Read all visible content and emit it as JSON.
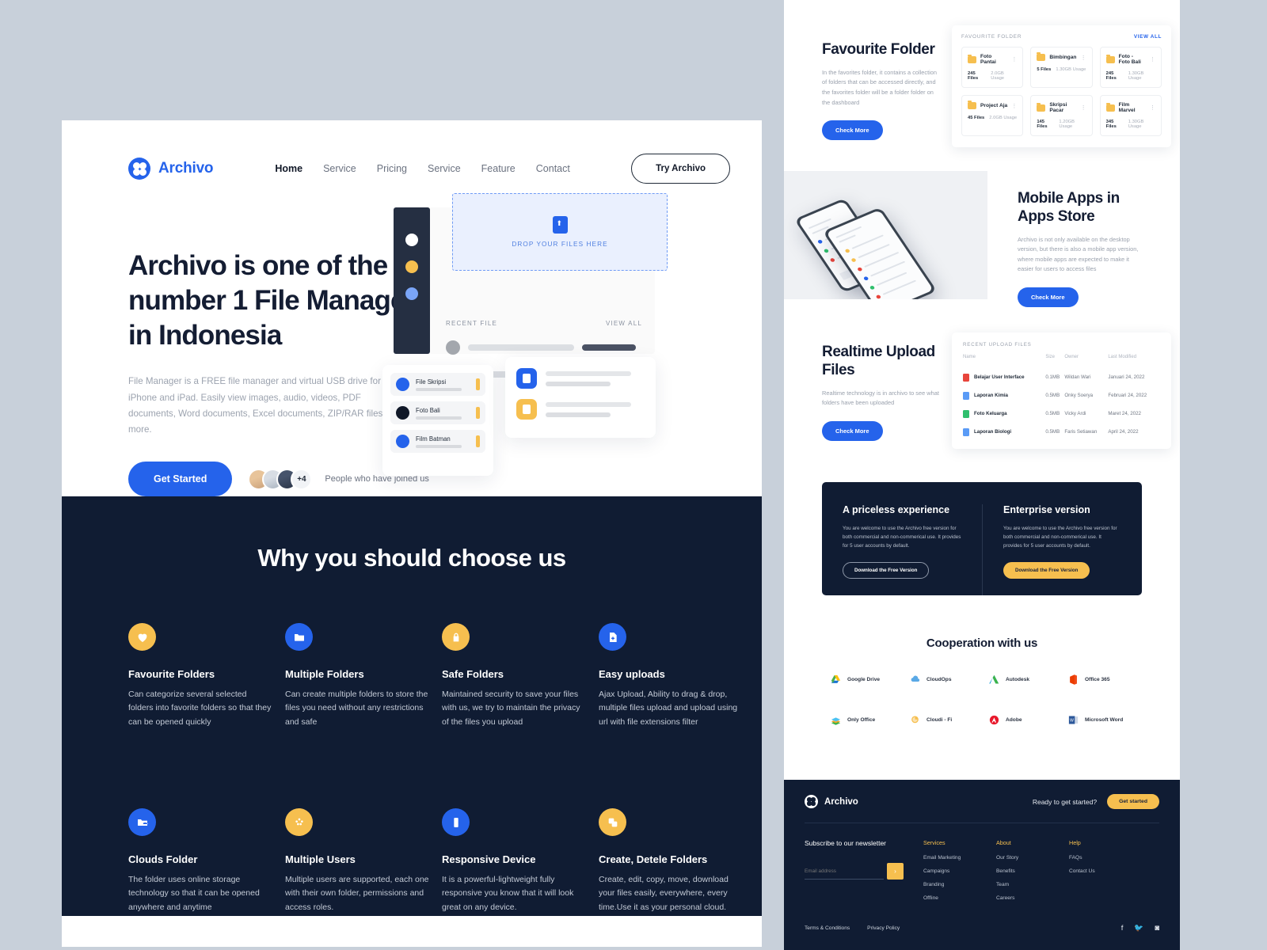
{
  "nav": {
    "brand": "Archivo",
    "links": [
      {
        "label": "Home",
        "active": true
      },
      {
        "label": "Service",
        "active": false
      },
      {
        "label": "Pricing",
        "active": false
      },
      {
        "label": "Service",
        "active": false
      },
      {
        "label": "Feature",
        "active": false
      },
      {
        "label": "Contact",
        "active": false
      }
    ],
    "cta": "Try Archivo"
  },
  "hero": {
    "title": "Archivo is one of the number 1 File Manager in Indonesia",
    "subtitle": "File Manager is a FREE file manager and virtual USB drive for the iPhone and iPad. Easily view images, audio, videos, PDF documents, Word documents, Excel documents, ZIP/RAR files and more.",
    "cta": "Get Started",
    "avatar_more": "+4",
    "joined_text": "People who have joined us",
    "dropzone_text": "DROP YOUR FILES HERE",
    "recent_label": "RECENT FILE",
    "view_all": "VIEW ALL",
    "files": [
      {
        "name": "File Skripsi",
        "color": "blue"
      },
      {
        "name": "Foto Bali",
        "color": "dark"
      },
      {
        "name": "Film Batman",
        "color": "blue"
      }
    ]
  },
  "why": {
    "title": "Why you should choose us",
    "features": [
      {
        "icon": "heart-icon",
        "tone": "yellow",
        "name": "Favourite Folders",
        "desc": "Can categorize several selected folders into favorite folders so that they can be opened quickly"
      },
      {
        "icon": "folder-icon",
        "tone": "blue",
        "name": "Multiple Folders",
        "desc": "Can create multiple folders to store the files you need without any restrictions and safe"
      },
      {
        "icon": "lock-icon",
        "tone": "yellow",
        "name": "Safe Folders",
        "desc": "Maintained security to save your files with us, we try to maintain the privacy of the files you upload"
      },
      {
        "icon": "upload-file-icon",
        "tone": "blue",
        "name": "Easy uploads",
        "desc": "Ajax Upload, Ability to drag & drop, multiple files upload and upload using url with file extensions filter"
      },
      {
        "icon": "cloud-folder-icon",
        "tone": "blue",
        "name": "Clouds Folder",
        "desc": "The folder uses online storage technology so that it can be opened anywhere and anytime"
      },
      {
        "icon": "users-icon",
        "tone": "yellow",
        "name": "Multiple Users",
        "desc": "Multiple users are supported, each one with their own folder, permissions and access roles."
      },
      {
        "icon": "mobile-icon",
        "tone": "blue",
        "name": "Responsive Device",
        "desc": "It is a powerful-lightweight fully responsive you know that it will look great on any device."
      },
      {
        "icon": "copy-icon",
        "tone": "yellow",
        "name": "Create, Detele Folders",
        "desc": "Create, edit, copy, move, download your files easily, everywhere, every time.Use it as your personal cloud."
      }
    ]
  },
  "favourite": {
    "heading": "Favourite Folder",
    "paragraph": "In the favorites folder, it contains a collection of folders that can be accessed directly, and the favorites folder will be a folder folder on the dashboard",
    "button": "Check More",
    "card_title": "FAVOURITE FOLDER",
    "view_all": "VIEW ALL",
    "folders": [
      {
        "name": "Foto Pantai",
        "files": "245 Files",
        "usage": "2.0GB Usage"
      },
      {
        "name": "Bimbingan",
        "files": "5 Files",
        "usage": "1.30GB Usage"
      },
      {
        "name": "Foto - Foto Bali",
        "files": "245 Files",
        "usage": "1.30GB Usage"
      },
      {
        "name": "Project Aja",
        "files": "45 Files",
        "usage": "2.0GB Usage"
      },
      {
        "name": "Skripsi Pacar",
        "files": "145 Files",
        "usage": "1.20GB Usage"
      },
      {
        "name": "Film Marvel",
        "files": "345 Files",
        "usage": "1.30GB Usage"
      }
    ]
  },
  "mobile": {
    "heading": "Mobile Apps in Apps Store",
    "paragraph": "Archivo is not only available on the desktop version, but there is also a mobile app version, where mobile apps are expected to make it easier for users to access files",
    "button": "Check More"
  },
  "realtime": {
    "heading": "Realtime Upload Files",
    "paragraph": "Realtime technology is in archivo to see what folders have been uploaded",
    "button": "Check More",
    "card_title": "RECENT UPLOAD FILES",
    "columns": [
      "Name",
      "Size",
      "Owner",
      "Last Modified"
    ],
    "rows": [
      {
        "name": "Belajar User Interface",
        "size": "0.1MB",
        "owner": "Wildan Wari",
        "modified": "Januari 24, 2022",
        "tone": "red"
      },
      {
        "name": "Laporan Kimia",
        "size": "0.5MB",
        "owner": "Onky Soerya",
        "modified": "Februari 24, 2022",
        "tone": "blue"
      },
      {
        "name": "Foto Keluarga",
        "size": "0.5MB",
        "owner": "Vicky Ardi",
        "modified": "Maret 24, 2022",
        "tone": "green"
      },
      {
        "name": "Laporan Biologi",
        "size": "0.5MB",
        "owner": "Faris Setiawan",
        "modified": "April 24, 2022",
        "tone": "blue"
      }
    ]
  },
  "pricing": {
    "left": {
      "heading": "A priceless experience",
      "paragraph": "You are welcome to use the Archivo free version for both commercial and non-commerical use. It provides for 5 user accounts by default.",
      "button": "Download the Free Version"
    },
    "right": {
      "heading": "Enterprise version",
      "paragraph": "You are welcome to use the Archivo free version for both commercial and non-commerical use. It provides for 5 user accounts by default.",
      "button": "Download the Free Version"
    }
  },
  "cooperation": {
    "heading": "Cooperation with us",
    "partners": [
      {
        "name": "Google Drive",
        "logo": "google-drive-logo"
      },
      {
        "name": "CloudOps",
        "logo": "cloudops-logo"
      },
      {
        "name": "Autodesk",
        "logo": "autodesk-logo"
      },
      {
        "name": "Office 365",
        "logo": "office365-logo"
      },
      {
        "name": "Only Office",
        "logo": "onlyoffice-logo"
      },
      {
        "name": "Cloudi - Fi",
        "logo": "cloudifi-logo"
      },
      {
        "name": "Adobe",
        "logo": "adobe-logo"
      },
      {
        "name": "Microsoft Word",
        "logo": "msword-logo"
      }
    ]
  },
  "footer": {
    "brand": "Archivo",
    "ready_text": "Ready to get started?",
    "get_started": "Get started",
    "newsletter_heading": "Subscribe to our newsletter",
    "email_placeholder": "Email address",
    "email_value": "",
    "submit_icon": "›",
    "columns": [
      {
        "heading": "Services",
        "items": [
          "Email Marketing",
          "Campaigns",
          "Branding",
          "Offline"
        ]
      },
      {
        "heading": "About",
        "items": [
          "Our Story",
          "Benefits",
          "Team",
          "Careers"
        ]
      },
      {
        "heading": "Help",
        "items": [
          "FAQs",
          "Contact Us"
        ]
      }
    ],
    "terms": "Terms & Conditions",
    "privacy": "Privacy Policy",
    "socials": [
      "facebook-icon",
      "twitter-icon",
      "instagram-icon"
    ]
  },
  "colors": {
    "accent_blue": "#2563eb",
    "accent_yellow": "#f6bf4f",
    "dark_navy": "#101c33",
    "page_bg": "#c8d0da"
  }
}
